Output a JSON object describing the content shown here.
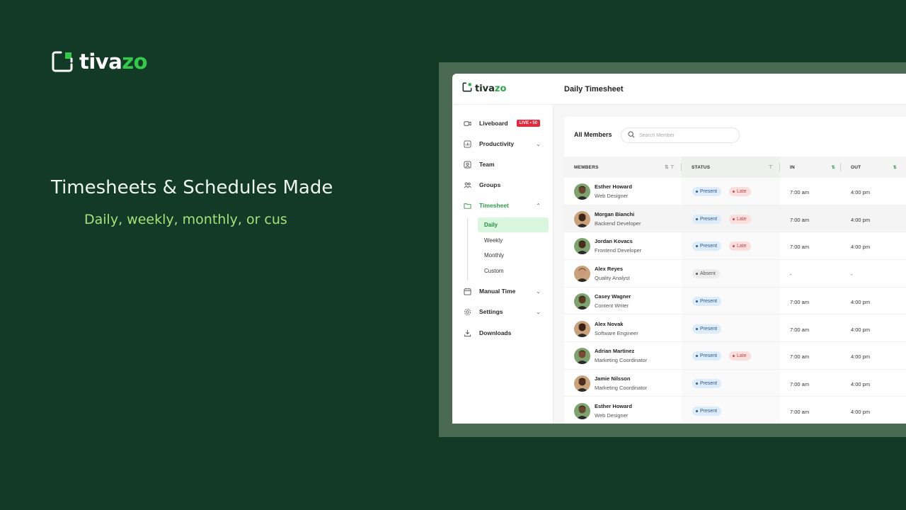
{
  "hero": {
    "brand_prefix": "tiva",
    "brand_suffix": "zo",
    "title": "Timesheets & Schedules Made",
    "subtitle": "Daily, weekly, monthly, or cus"
  },
  "app": {
    "brand_prefix": "tiva",
    "brand_suffix": "zo",
    "page_title": "Daily Timesheet",
    "sidebar": {
      "items": [
        {
          "label": "Liveboard",
          "icon": "liveboard-icon",
          "badge": "LIVE • 50"
        },
        {
          "label": "Productivity",
          "icon": "chart-icon"
        },
        {
          "label": "Team",
          "icon": "user-icon"
        },
        {
          "label": "Groups",
          "icon": "groups-icon"
        },
        {
          "label": "Timesheet",
          "icon": "folder-icon"
        },
        {
          "label": "Manual Time",
          "icon": "calendar-icon"
        },
        {
          "label": "Settings",
          "icon": "gear-icon"
        },
        {
          "label": "Downloads",
          "icon": "download-icon"
        }
      ],
      "timesheet_sub": [
        "Daily",
        "Weekly",
        "Monthly",
        "Custom"
      ]
    },
    "card": {
      "title": "All Members",
      "search_placeholder": "Search Member",
      "columns": [
        "MEMBERS",
        "STATUS",
        "IN",
        "OUT"
      ]
    },
    "rows": [
      {
        "name": "Esther Howard",
        "role": "Web Designer",
        "status": "Present",
        "late": "Late",
        "in": "7:00 am",
        "out": "4:00 pm"
      },
      {
        "name": "Morgan Bianchi",
        "role": "Backend Developer",
        "status": "Present",
        "late": "Late",
        "in": "7:00 am",
        "out": "4:00 pm"
      },
      {
        "name": "Jordan Kovacs",
        "role": "Frontend Developer",
        "status": "Present",
        "late": "Late",
        "in": "7:00 am",
        "out": "4:00 pm"
      },
      {
        "name": "Alex Reyes",
        "role": "Quality Analyst",
        "status": "Absent",
        "late": "",
        "in": "-",
        "out": "-"
      },
      {
        "name": "Casey Wagner",
        "role": "Content Writer",
        "status": "Present",
        "late": "",
        "in": "7:00 am",
        "out": "4:00 pm"
      },
      {
        "name": "Alex Novak",
        "role": "Software Engineer",
        "status": "Present",
        "late": "",
        "in": "7:00 am",
        "out": "4:00 pm"
      },
      {
        "name": "Adrian Martinez",
        "role": "Marketing Coordinator",
        "status": "Present",
        "late": "Late",
        "in": "7:00 am",
        "out": "4:00 pm"
      },
      {
        "name": "Jamie Nilsson",
        "role": "Marketing Coordinator",
        "status": "Present",
        "late": "",
        "in": "7:00 am",
        "out": "4:00 pm"
      },
      {
        "name": "Esther Howard",
        "role": "Web Designer",
        "status": "Present",
        "late": "",
        "in": "7:00 am",
        "out": "4:00 pm"
      }
    ]
  },
  "colors": {
    "background": "#123a26",
    "brand_green": "#34c94a",
    "subtitle": "#a7e07a"
  }
}
